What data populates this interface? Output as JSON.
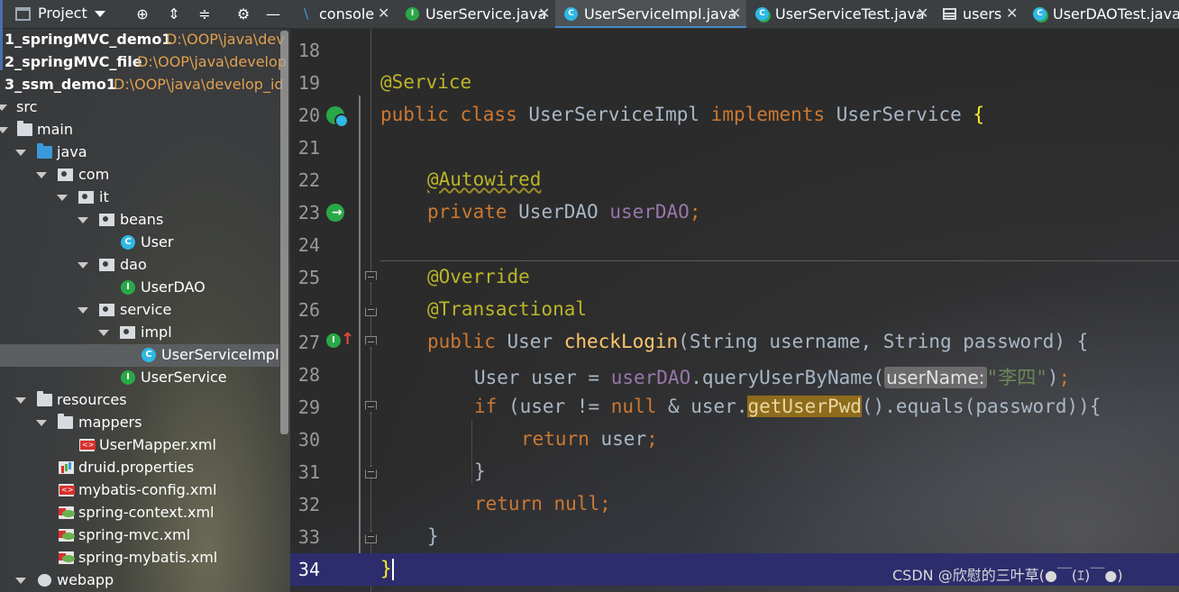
{
  "project_panel": {
    "title": "Project",
    "tree": [
      {
        "label": "1_springMVC_demo1",
        "path": "D:\\OOP\\java\\dev",
        "bold": true
      },
      {
        "label": "2_springMVC_file",
        "path": "D:\\OOP\\java\\develop",
        "bold": true
      },
      {
        "label": "3_ssm_demo1",
        "path": "D:\\OOP\\java\\develop_id",
        "bold": true
      },
      {
        "label": "src"
      },
      {
        "label": "main"
      },
      {
        "label": "java"
      },
      {
        "label": "com"
      },
      {
        "label": "it"
      },
      {
        "label": "beans"
      },
      {
        "label": "User"
      },
      {
        "label": "dao"
      },
      {
        "label": "UserDAO"
      },
      {
        "label": "service"
      },
      {
        "label": "impl"
      },
      {
        "label": "UserServiceImpl",
        "selected": true
      },
      {
        "label": "UserService"
      },
      {
        "label": "resources"
      },
      {
        "label": "mappers"
      },
      {
        "label": "UserMapper.xml"
      },
      {
        "label": "druid.properties"
      },
      {
        "label": "mybatis-config.xml"
      },
      {
        "label": "spring-context.xml"
      },
      {
        "label": "spring-mvc.xml"
      },
      {
        "label": "spring-mybatis.xml"
      },
      {
        "label": "webapp"
      }
    ]
  },
  "tabs": [
    {
      "label": "console",
      "icon": "console-icon"
    },
    {
      "label": "UserService.java",
      "icon": "interface-icon"
    },
    {
      "label": "UserServiceImpl.java",
      "icon": "class-icon",
      "active": true
    },
    {
      "label": "UserServiceTest.java",
      "icon": "test-class-icon"
    },
    {
      "label": "users",
      "icon": "table-icon"
    },
    {
      "label": "UserDAOTest.java",
      "icon": "test-class-icon"
    }
  ],
  "tab_close": "✕",
  "editor": {
    "line_numbers": [
      "18",
      "19",
      "20",
      "21",
      "22",
      "23",
      "24",
      "25",
      "26",
      "27",
      "28",
      "29",
      "30",
      "31",
      "32",
      "33",
      "34"
    ],
    "current_line": "34",
    "code": {
      "l19": {
        "ann": "@Service"
      },
      "l20": {
        "kw1": "public class ",
        "name": "UserServiceImpl ",
        "kw2": "implements ",
        "iface": "UserService ",
        "brace": "{"
      },
      "l22": {
        "ann": "@Autowired"
      },
      "l23": {
        "kw": "private ",
        "type": "UserDAO ",
        "field": "userDAO",
        "semi": ";"
      },
      "l25": {
        "ann": "@Override"
      },
      "l26": {
        "ann": "@Transactional"
      },
      "l27": {
        "kw": "public ",
        "type": "User ",
        "method": "checkLogin",
        "params": "(String username, String password) {"
      },
      "l28": {
        "pre": "User user = ",
        "field": "userDAO",
        "call": ".queryUserByName(",
        "hint": "userName:",
        "str": "\"李四\"",
        "post": ")",
        "semi": ";"
      },
      "l29": {
        "kw": "if ",
        "pre": "(user != ",
        "null": "null",
        "mid": " & user.",
        "hl": "getUserPwd",
        "post": "().equals(password)){"
      },
      "l30": {
        "kw": "return ",
        "val": "user",
        "semi": ";"
      },
      "l31": {
        "brace": "}"
      },
      "l32": {
        "kw": "return ",
        "null": "null",
        "semi": ";"
      },
      "l33": {
        "brace": "}"
      },
      "l34": {
        "brace": "}"
      }
    }
  },
  "watermark": "CSDN @欣慰的三叶草(●￣(ｴ)￣●)"
}
